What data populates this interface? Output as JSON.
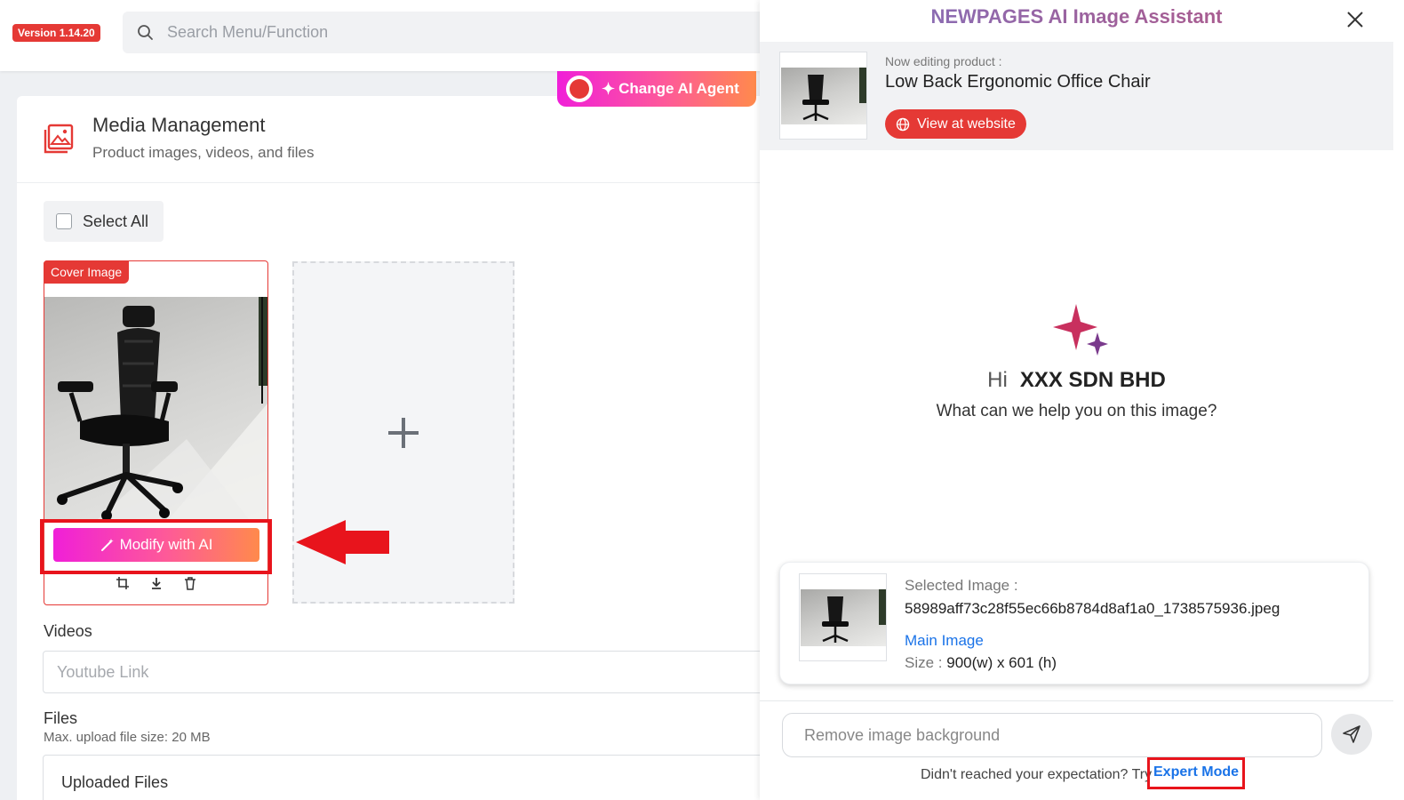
{
  "header": {
    "version": "Version 1.14.20",
    "search_placeholder": "Search Menu/Function"
  },
  "agent": {
    "change_label": "Change AI Agent"
  },
  "media": {
    "title": "Media Management",
    "subtitle": "Product images, videos, and files",
    "select_all": "Select All",
    "cover_badge": "Cover Image",
    "modify_label": "Modify with AI",
    "videos_label": "Videos",
    "youtube_placeholder": "Youtube Link",
    "files_label": "Files",
    "files_sub": "Max. upload file size: 20 MB",
    "uploaded_files": "Uploaded Files"
  },
  "panel": {
    "title": "NEWPAGES AI Image Assistant",
    "now_editing": "Now editing product :",
    "product_name": "Low Back Ergonomic Office Chair",
    "view_button": "View at website",
    "hi": "Hi",
    "company": "XXX SDN BHD",
    "help": "What can we help you on this image?",
    "selected_label": "Selected Image :",
    "filename": "58989aff73c28f55ec66b8784d8af1a0_1738575936.jpeg",
    "main_image": "Main Image",
    "size_key": "Size :",
    "size_value": "900(w) x 601 (h)",
    "prompt_placeholder": "Remove image background",
    "footer": "Didn't reached your expectation? Try",
    "expert_mode": "Expert Mode"
  },
  "colors": {
    "accent_red": "#e53935",
    "highlight_red": "#e8141c",
    "link_blue": "#1a73e8",
    "gradient_start": "#f01fd8",
    "gradient_end": "#ff8a4c"
  },
  "icons": [
    "search-icon",
    "media-icon",
    "agent-logo-icon",
    "sparkle-icon",
    "magic-wand-icon",
    "crop-icon",
    "download-icon",
    "trash-icon",
    "plus-icon",
    "close-icon",
    "globe-icon",
    "sparkles-icon",
    "send-icon",
    "arrow-icon"
  ]
}
